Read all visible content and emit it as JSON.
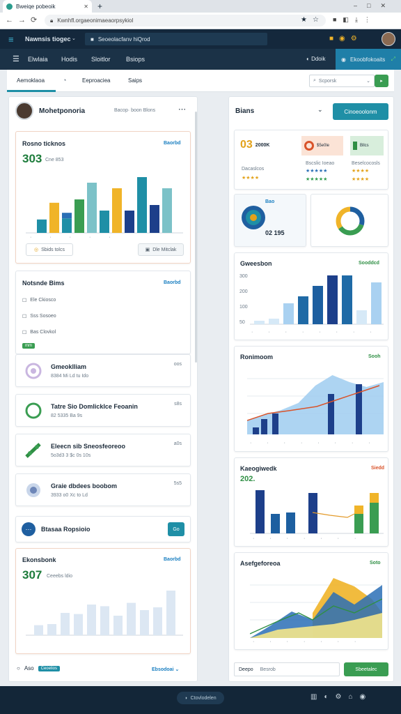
{
  "browser": {
    "tab_title": "Bweiqe pobeoik",
    "url": "Kwnhfl.orgaeonimaeaorpsykiol"
  },
  "appbar": {
    "title": "Nawnsis tiogec",
    "search": "Seoeolacfanv hiQrod"
  },
  "navbar": {
    "items": [
      "Elwlaia",
      "Hodis",
      "Sloitlor",
      "Bsiops"
    ],
    "right_label": "Ddoik",
    "cta": "Ekoobfokoaits"
  },
  "subbar": {
    "tabs": [
      "Aemoklaoa",
      "Eeproaciea",
      "Saips"
    ],
    "search_placeholder": "Scporsk"
  },
  "left": {
    "header": {
      "name": "Mohetponoria",
      "meta": "Bacop· boon Blons"
    },
    "chart1": {
      "title": "Rosno ticknos",
      "link": "Baorbd",
      "value": "303",
      "sub": "Cne 853",
      "btn_left": "Sbids tolcs",
      "btn_right": "Dle Mitclak"
    },
    "notes": {
      "title": "Notsnde Bims",
      "link": "Baorbd",
      "items": [
        "Ele Ckiosco",
        "Sss Sosoeo",
        "Bas Clovkol"
      ],
      "tag": "mm"
    },
    "list": [
      {
        "title": "Gmeoklliam",
        "sub": "8384 Mi Ld tu Ido",
        "value": "oos"
      },
      {
        "title": "Tatre Sio Domlicklce Feoanin",
        "sub": "82 5335  Ba 9s",
        "value": "s8s"
      },
      {
        "title": "Eleecn sib Sneosfeoreoo",
        "sub": "5o3d3 3 $c   0s 10s",
        "value": "a0s"
      },
      {
        "title": "Graie dbdees boobom",
        "sub": "3933 o0  Xc to  Ld",
        "value": "5s5"
      }
    ],
    "banner": {
      "title": "Btasaa Ropsioio",
      "btn": "Go"
    },
    "chart2": {
      "title": "Ekonsbonk",
      "link": "Baorbd",
      "value": "307",
      "sub": "Ceeebs ldio"
    },
    "footer": {
      "label": "Aso",
      "badge": "Ceoelios",
      "link": "Ebsodoai"
    }
  },
  "right": {
    "header": {
      "title": "Bians",
      "btn": "Cinoeoolonm"
    },
    "stats": [
      {
        "value": "03",
        "label": "2000K",
        "sub": "Dacaslcos"
      },
      {
        "value": "",
        "label": "$5e0le",
        "sub": "Bscslic Ioeao"
      },
      {
        "value": "",
        "label": "Bllcs",
        "sub": "Beselcocosls"
      }
    ],
    "donut1": {
      "label": "Bao",
      "value": "02 195"
    },
    "chart3": {
      "title": "Gweesbon",
      "link": "Sooddcd"
    },
    "chart4": {
      "title": "Ronimoom",
      "link": "Sooh"
    },
    "chart5": {
      "title": "Kaeogiwedk",
      "value": "202.",
      "link": "Siedd"
    },
    "chart6": {
      "title": "Asefgeforeoa",
      "link": "Soto"
    },
    "footer": {
      "input": "Deepo",
      "input2": "Besrob",
      "btn": "Sbeetalec"
    }
  },
  "bottombar": {
    "label": "Ctovlodelen"
  },
  "colors": {
    "navy": "#14283c",
    "teal": "#1f8fa6",
    "green": "#3a9d52",
    "gold": "#f0b429",
    "blue": "#1d5fa0",
    "lightblue": "#a9d1f1"
  },
  "chart_data": [
    {
      "type": "bar",
      "title": "Rosno ticknos",
      "series": [
        {
          "values": [
            12,
            27,
            13,
            30,
            45,
            20,
            40,
            20,
            50,
            25,
            40
          ]
        },
        {
          "values": [
            0,
            0,
            13,
            0,
            0,
            0,
            0,
            0,
            0,
            0,
            0
          ]
        }
      ]
    },
    {
      "type": "bar",
      "title": "Gweesbon",
      "ylabels": [
        "300",
        "200",
        "100",
        "50"
      ],
      "values": [
        5,
        8,
        30,
        40,
        55,
        70,
        70,
        20,
        60
      ]
    },
    {
      "type": "area",
      "title": "Ronimoom",
      "values": [
        20,
        28,
        35,
        45,
        70,
        85,
        75,
        68,
        75
      ]
    },
    {
      "type": "bar",
      "title": "Kaeogiwedk",
      "values": [
        62,
        28,
        30,
        58,
        40,
        44
      ]
    },
    {
      "type": "area",
      "title": "Asefgeforeoa",
      "values": [
        10,
        25,
        40,
        48,
        60,
        85,
        75,
        95
      ]
    },
    {
      "type": "bar",
      "title": "Ekonsbonk",
      "values": [
        18,
        20,
        40,
        38,
        55,
        52,
        35,
        58,
        45,
        50,
        80
      ]
    }
  ]
}
